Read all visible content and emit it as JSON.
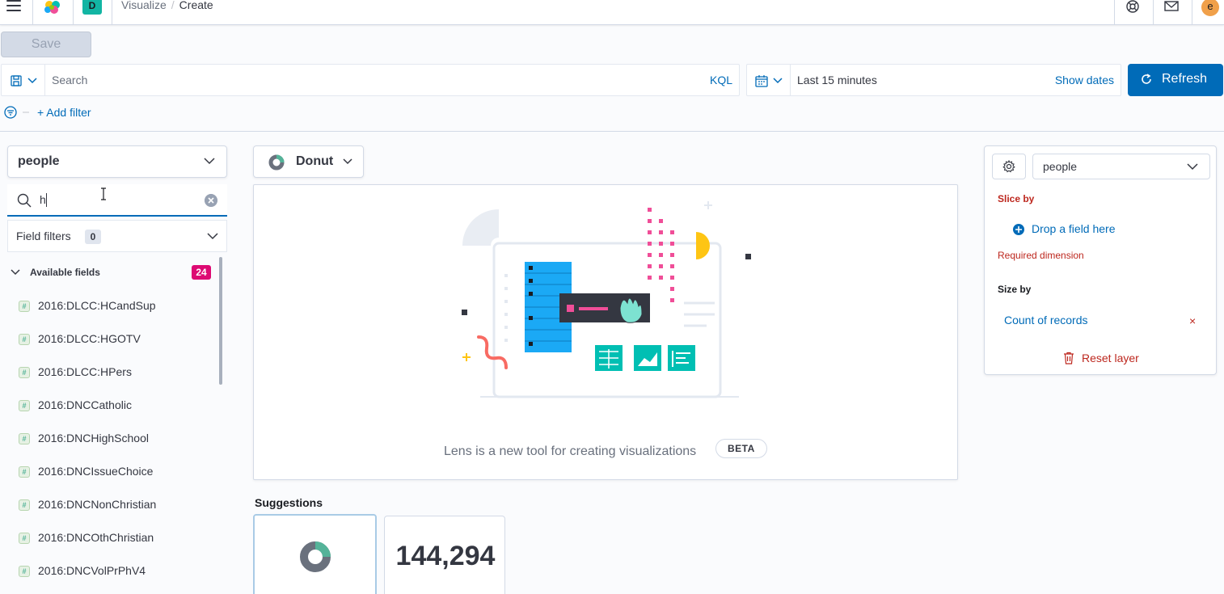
{
  "header": {
    "space_initial": "D",
    "breadcrumb_parent": "Visualize",
    "breadcrumb_separator": "/",
    "breadcrumb_current": "Create",
    "user_initial": "e"
  },
  "toolbar": {
    "save_label": "Save"
  },
  "query": {
    "placeholder": "Search",
    "language": "KQL",
    "time_range": "Last 15 minutes",
    "show_dates": "Show dates",
    "refresh_label": "Refresh",
    "add_filter": "+ Add filter"
  },
  "left_panel": {
    "index_pattern": "people",
    "search_value": "h",
    "field_filters_label": "Field filters",
    "field_filters_count": "0",
    "available_label": "Available fields",
    "available_count": "24",
    "fields": [
      "2016:DLCC:HCandSup",
      "2016:DLCC:HGOTV",
      "2016:DLCC:HPers",
      "2016:DNCCatholic",
      "2016:DNCHighSchool",
      "2016:DNCIssueChoice",
      "2016:DNCNonChristian",
      "2016:DNCOthChristian",
      "2016:DNCVolPrPhV4"
    ],
    "field_type_glyph": "#"
  },
  "workspace": {
    "chart_type": "Donut",
    "message": "Lens is a new tool for creating visualizations",
    "beta": "BETA",
    "suggestions_title": "Suggestions",
    "suggestion_metric": "144,294"
  },
  "config_panel": {
    "layer_index": "people",
    "slice_by": "Slice by",
    "drop_field": "Drop a field here",
    "required": "Required dimension",
    "size_by": "Size by",
    "size_metric": "Count of records",
    "remove_glyph": "×",
    "reset_layer": "Reset layer"
  },
  "colors": {
    "primary": "#006bb8",
    "danger": "#bd271e",
    "accent_pink": "#dd0a73",
    "teal": "#12b5a3"
  }
}
